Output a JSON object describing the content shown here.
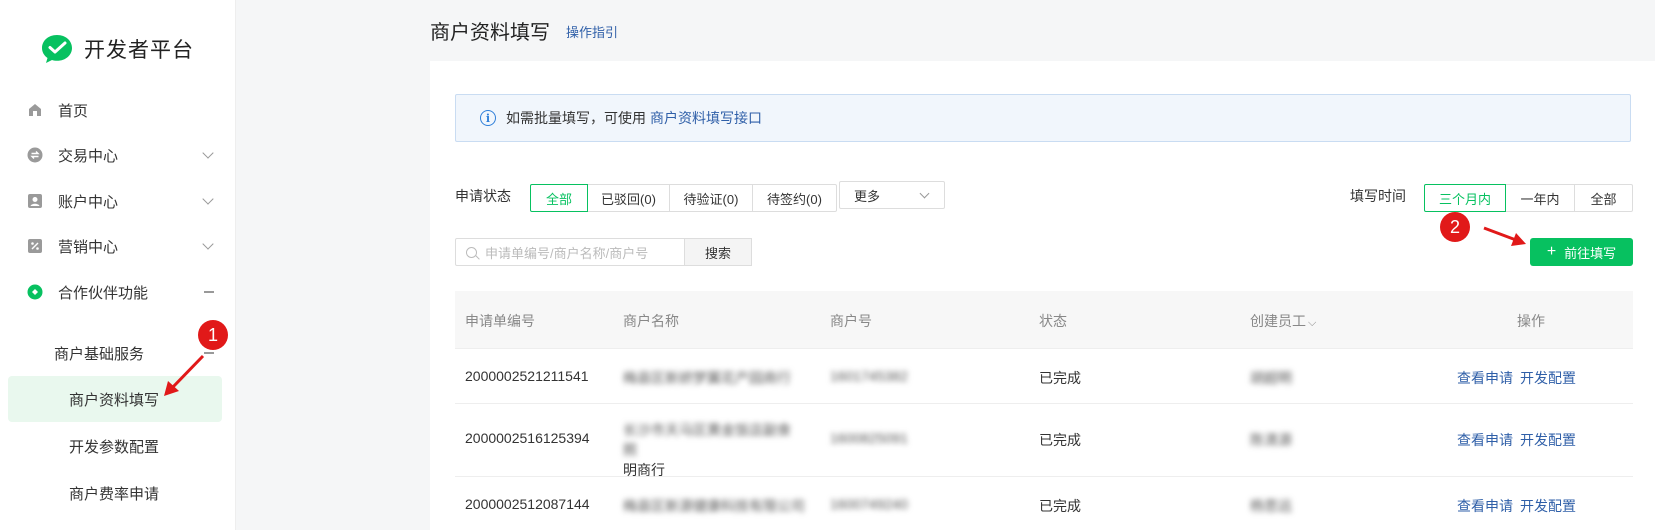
{
  "brand": {
    "name": "开发者平台",
    "color": "#07c160"
  },
  "sidebar": {
    "items": [
      {
        "label": "首页",
        "icon": "home-icon"
      },
      {
        "label": "交易中心",
        "icon": "exchange-icon"
      },
      {
        "label": "账户中心",
        "icon": "account-icon"
      },
      {
        "label": "营销中心",
        "icon": "percent-icon"
      },
      {
        "label": "合作伙伴功能",
        "icon": "partner-icon"
      }
    ],
    "group": "商户基础服务",
    "sub_items": [
      {
        "label": "商户资料填写",
        "active": true
      },
      {
        "label": "开发参数配置"
      },
      {
        "label": "商户费率申请"
      }
    ]
  },
  "header": {
    "title": "商户资料填写",
    "guide": "操作指引"
  },
  "notice": {
    "text": "如需批量填写，可使用",
    "link": "商户资料填写接口"
  },
  "filters": {
    "status_label": "申请状态",
    "status_tabs": [
      "全部",
      "已驳回(0)",
      "待验证(0)",
      "待签约(0)"
    ],
    "status_more": "更多",
    "time_label": "填写时间",
    "time_tabs": [
      "三个月内",
      "一年内",
      "全部"
    ]
  },
  "search": {
    "placeholder": "申请单编号/商户名称/商户号",
    "button": "搜索"
  },
  "create_button": "前往填写",
  "table": {
    "columns": [
      "申请单编号",
      "商户名称",
      "商户号",
      "状态",
      "创建员工",
      "操作"
    ],
    "rows": [
      {
        "id": "2000002521211541",
        "name": "梅县区新娇梦翼花产园商行",
        "mchid": "1601745382",
        "status": "已完成",
        "staff": "胡超明"
      },
      {
        "id": "2000002516125394",
        "name": "长沙市天马区黄金饭店副食照",
        "name2": "明商行",
        "mchid": "1600825091",
        "status": "已完成",
        "staff": "陈清源"
      },
      {
        "id": "2000002512087144",
        "name": "梅县区新源健康科技有限公司",
        "mchid": "1600749240",
        "status": "已完成",
        "staff": "杨思远"
      }
    ],
    "actions": [
      "查看申请",
      "开发配置"
    ]
  },
  "annotations": [
    "1",
    "2"
  ]
}
